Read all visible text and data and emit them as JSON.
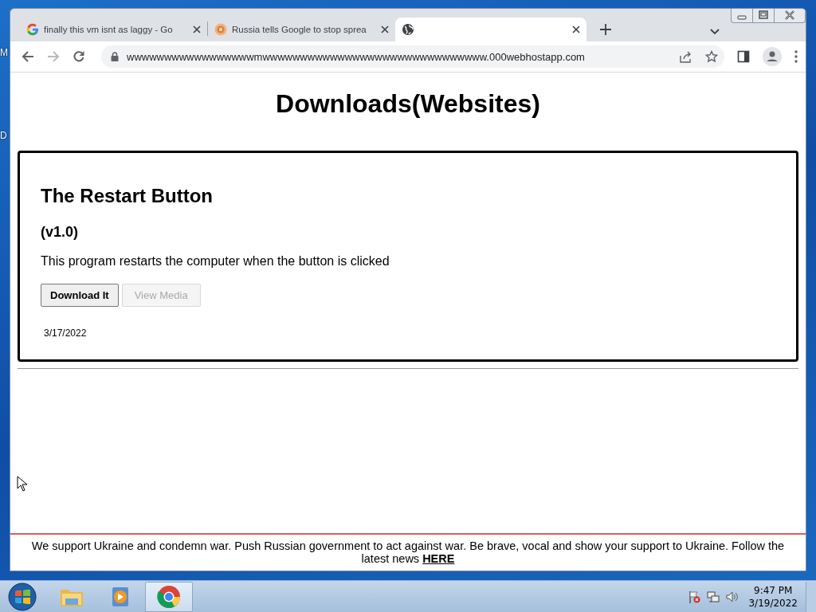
{
  "desktop": {
    "labels": [
      "M",
      "D"
    ]
  },
  "browser": {
    "tabs": [
      {
        "kind": "google",
        "title": "finally this vm isnt as laggy - Go",
        "selected": false
      },
      {
        "kind": "news",
        "title": "Russia tells Google to stop sprea",
        "selected": false
      },
      {
        "kind": "globe",
        "selected": true
      }
    ],
    "address": "wwwwwwwwwwwwwwwwwmwwwwwwwwwwwwwwwwwwwwwwwwwwwwww.000webhostapp.com"
  },
  "page": {
    "heading": "Downloads(Websites)",
    "card": {
      "title": "The Restart Button",
      "version": "(v1.0)",
      "description": "This program restarts the computer when the button is clicked",
      "buttons": [
        {
          "label": "Download It",
          "disabled": false
        },
        {
          "label": "View Media",
          "disabled": true
        }
      ],
      "date": "3/17/2022"
    },
    "banner": {
      "text": "We support Ukraine and condemn war. Push Russian government to act against war. Be brave, vocal and show your support to Ukraine. Follow the latest news",
      "link": "HERE"
    }
  },
  "taskbar": {
    "apps": [
      {
        "kind": "explorer",
        "selected": false
      },
      {
        "kind": "media",
        "selected": false
      },
      {
        "kind": "chrome",
        "selected": true
      }
    ],
    "time": "9:47 PM",
    "date": "3/19/2022"
  }
}
